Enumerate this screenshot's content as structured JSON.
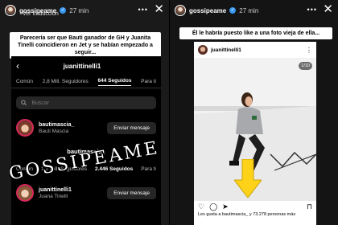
{
  "left_story": {
    "username": "gossipeame",
    "time": "27 min",
    "translate_label": "Ver traducción",
    "caption": "Parecería ser que Bauti ganador de GH y Juanita Tinelli coincidieron en Jet y se habían empezado a seguir...",
    "profile": {
      "username": "juanittinelli1",
      "tabs": [
        "Común",
        "2,8 Mill. Seguidores",
        "644 Seguidos",
        "Para ti"
      ],
      "active_tab": 2,
      "search_placeholder": "Buscar",
      "rows": [
        {
          "username": "bautimascia_",
          "fullname": "Bauti Mascia",
          "button": "Enviar mensaje"
        },
        {
          "username": "juanittinelli1",
          "fullname": "Juana Tinelli",
          "button": "Enviar mensaje"
        }
      ],
      "second_profile_name": "bautimascia_",
      "second_stats": [
        "Común",
        "1,2 Mill. Seguidores",
        "2.446 Seguidos",
        "Para ti"
      ]
    },
    "watermark": "GOSSIPEAME"
  },
  "right_story": {
    "username": "gossipeame",
    "time": "27 min",
    "caption": "Él le habría puesto like a una foto vieja de ella...",
    "post": {
      "username": "juanittinelli1",
      "counter": "1/10",
      "likes_text": "Les gusta a bautimascia_ y 73.278 personas más"
    }
  },
  "colors": {
    "accent_yellow": "#ffd21a",
    "verified_blue": "#3897f0",
    "story_ring": "#d9295a"
  }
}
